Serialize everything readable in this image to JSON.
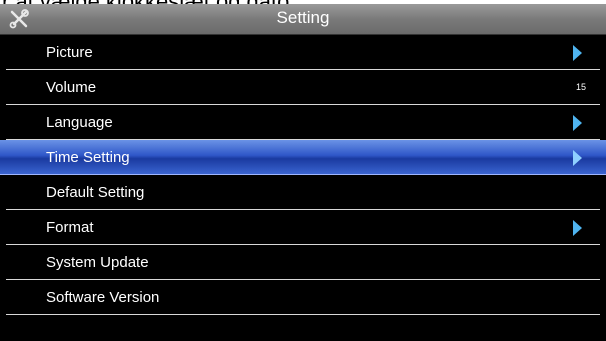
{
  "caption": "r at vælge klokkeslæt og dato",
  "header": {
    "title": "Setting",
    "icon": "tools-icon"
  },
  "menu": {
    "items": [
      {
        "label": "Picture",
        "value": "",
        "has_arrow": true
      },
      {
        "label": "Volume",
        "value": "15",
        "has_arrow": false
      },
      {
        "label": "Language",
        "value": "",
        "has_arrow": true
      },
      {
        "label": "Time Setting",
        "value": "",
        "has_arrow": true,
        "selected": true
      },
      {
        "label": "Default Setting",
        "value": "",
        "has_arrow": false
      },
      {
        "label": "Format",
        "value": "",
        "has_arrow": true
      },
      {
        "label": "System Update",
        "value": "",
        "has_arrow": false
      },
      {
        "label": "Software Version",
        "value": "",
        "has_arrow": false
      }
    ]
  },
  "colors": {
    "background": "#000000",
    "selection": "#2f57c8",
    "arrow": "#4fb4f0",
    "titlebar": "#7a7a7a"
  }
}
